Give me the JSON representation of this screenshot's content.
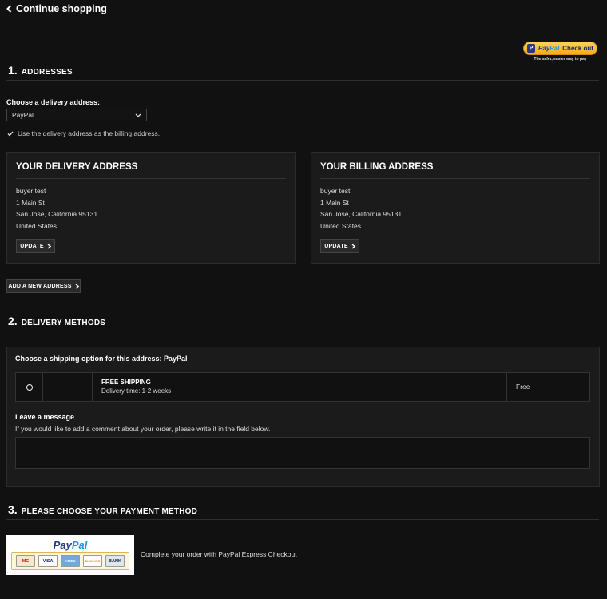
{
  "nav": {
    "continue_label": "Continue shopping",
    "back_icon": "chevron-left-icon"
  },
  "paypal_checkout": {
    "brand_part1": "Pay",
    "brand_part2": "Pal",
    "action": "Check out",
    "tagline": "The safer, easier way to pay"
  },
  "addresses": {
    "number": "1.",
    "title": "ADDRESSES",
    "choose_label": "Choose a delivery address:",
    "selected": "PayPal",
    "same_billing_label": "Use the delivery address as the billing address.",
    "same_billing_checked": true,
    "delivery": {
      "title": "YOUR DELIVERY ADDRESS",
      "lines": [
        "buyer test",
        "1 Main St",
        "San Jose, California 95131",
        "United States"
      ],
      "update_label": "UPDATE"
    },
    "billing": {
      "title": "YOUR BILLING ADDRESS",
      "lines": [
        "buyer test",
        "1 Main St",
        "San Jose, California 95131",
        "United States"
      ],
      "update_label": "UPDATE"
    },
    "add_new_label": "ADD A NEW ADDRESS"
  },
  "delivery_methods": {
    "number": "2.",
    "title": "DELIVERY METHODS",
    "choose_label": "Choose a shipping option for this address: PayPal",
    "option": {
      "name": "FREE SHIPPING",
      "delivery_time": "Delivery time: 1-2 weeks",
      "price": "Free"
    },
    "message_label": "Leave a message",
    "message_hint": "If you would like to add a comment about your order, please write it in the field below.",
    "message_value": ""
  },
  "payment": {
    "number": "3.",
    "title": "PLEASE CHOOSE YOUR PAYMENT METHOD",
    "logo_part1": "Pay",
    "logo_part2": "Pal",
    "cards": [
      "MC",
      "VISA",
      "AMEX",
      "DISCOVER",
      "BANK"
    ],
    "description": "Complete your order with PayPal Express Checkout"
  },
  "colors": {
    "background": "#111111",
    "card": "#1b1b1b",
    "paypal_gold": "#ffc439",
    "paypal_navy": "#253b80",
    "paypal_blue": "#179bd7"
  }
}
